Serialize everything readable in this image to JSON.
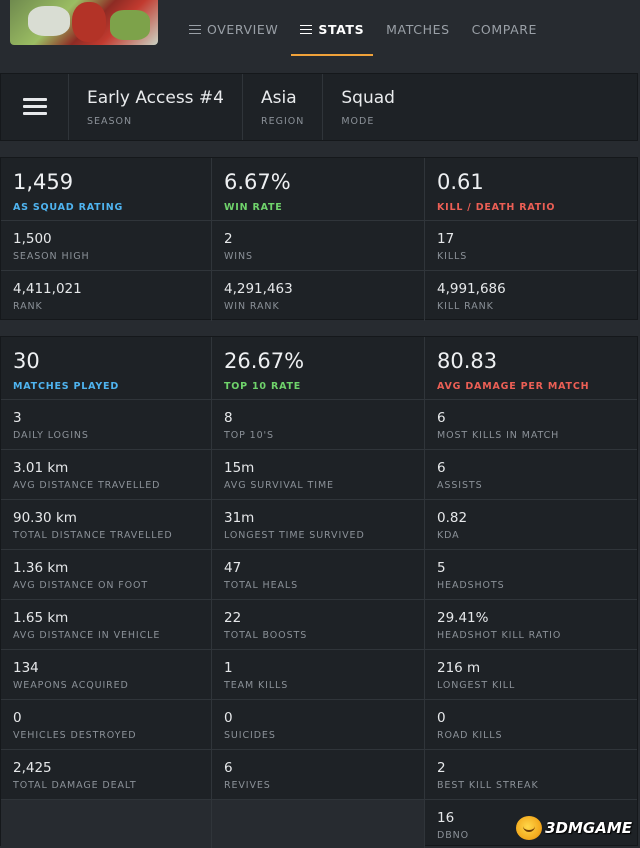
{
  "nav": {
    "tabs": [
      {
        "label": "OVERVIEW",
        "active": false
      },
      {
        "label": "STATS",
        "active": true
      },
      {
        "label": "MATCHES",
        "active": false
      },
      {
        "label": "COMPARE",
        "active": false
      }
    ]
  },
  "filters": {
    "season": {
      "value": "Early Access #4",
      "label": "SEASON"
    },
    "region": {
      "value": "Asia",
      "label": "REGION"
    },
    "mode": {
      "value": "Squad",
      "label": "MODE"
    }
  },
  "summary": {
    "rating": {
      "value": "1,459",
      "label": "AS SQUAD RATING"
    },
    "win_rate": {
      "value": "6.67%",
      "label": "WIN RATE"
    },
    "kd_ratio": {
      "value": "0.61",
      "label": "KILL / DEATH RATIO"
    },
    "rows": [
      [
        {
          "value": "1,500",
          "label": "SEASON HIGH"
        },
        {
          "value": "2",
          "label": "WINS"
        },
        {
          "value": "17",
          "label": "KILLS"
        }
      ],
      [
        {
          "value": "4,411,021",
          "label": "RANK"
        },
        {
          "value": "4,291,463",
          "label": "WIN RANK"
        },
        {
          "value": "4,991,686",
          "label": "KILL RANK"
        }
      ]
    ]
  },
  "details": {
    "matches_played": {
      "value": "30",
      "label": "MATCHES PLAYED"
    },
    "top10_rate": {
      "value": "26.67%",
      "label": "TOP 10 RATE"
    },
    "avg_damage": {
      "value": "80.83",
      "label": "AVG DAMAGE PER MATCH"
    },
    "rows": [
      [
        {
          "value": "3",
          "label": "DAILY LOGINS"
        },
        {
          "value": "8",
          "label": "TOP 10'S"
        },
        {
          "value": "6",
          "label": "MOST KILLS IN MATCH"
        }
      ],
      [
        {
          "value": "3.01 km",
          "label": "AVG DISTANCE TRAVELLED"
        },
        {
          "value": "15m",
          "label": "AVG SURVIVAL TIME"
        },
        {
          "value": "6",
          "label": "ASSISTS"
        }
      ],
      [
        {
          "value": "90.30 km",
          "label": "TOTAL DISTANCE TRAVELLED"
        },
        {
          "value": "31m",
          "label": "LONGEST TIME SURVIVED"
        },
        {
          "value": "0.82",
          "label": "KDA"
        }
      ],
      [
        {
          "value": "1.36 km",
          "label": "AVG DISTANCE ON FOOT"
        },
        {
          "value": "47",
          "label": "TOTAL HEALS"
        },
        {
          "value": "5",
          "label": "HEADSHOTS"
        }
      ],
      [
        {
          "value": "1.65 km",
          "label": "AVG DISTANCE IN VEHICLE"
        },
        {
          "value": "22",
          "label": "TOTAL BOOSTS"
        },
        {
          "value": "29.41%",
          "label": "HEADSHOT KILL RATIO"
        }
      ],
      [
        {
          "value": "134",
          "label": "WEAPONS ACQUIRED"
        },
        {
          "value": "1",
          "label": "TEAM KILLS"
        },
        {
          "value": "216 m",
          "label": "LONGEST KILL"
        }
      ],
      [
        {
          "value": "0",
          "label": "VEHICLES DESTROYED"
        },
        {
          "value": "0",
          "label": "SUICIDES"
        },
        {
          "value": "0",
          "label": "ROAD KILLS"
        }
      ],
      [
        {
          "value": "2,425",
          "label": "TOTAL DAMAGE DEALT"
        },
        {
          "value": "6",
          "label": "REVIVES"
        },
        {
          "value": "2",
          "label": "BEST KILL STREAK"
        }
      ]
    ],
    "dbno": {
      "value": "16",
      "label": "DBNO"
    }
  },
  "watermark": {
    "text": "3DMGAME"
  },
  "colors": {
    "accent": "#f0a23a",
    "blue_label": "#4fb4f0",
    "green_label": "#6fd36b",
    "red_label": "#ec5f55",
    "panel": "#1e2226",
    "background": "#272b30"
  },
  "icons": {
    "tab_icon": "list-icon",
    "filter_menu": "hamburger-icon",
    "watermark_logo": "smiley-logo-icon"
  }
}
